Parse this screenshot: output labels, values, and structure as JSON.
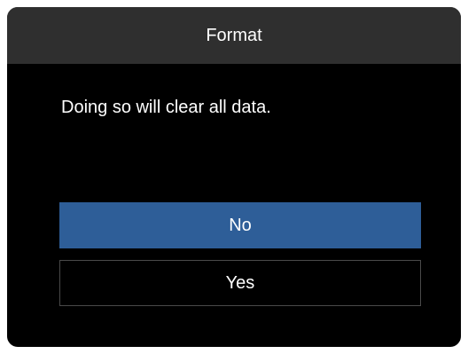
{
  "dialog": {
    "title": "Format",
    "message": "Doing so will clear all data.",
    "options": [
      {
        "label": "No",
        "selected": true
      },
      {
        "label": "Yes",
        "selected": false
      }
    ]
  },
  "colors": {
    "background": "#000000",
    "title_bar": "#2f2f2f",
    "selected_option": "#2e5e98",
    "unselected_border": "#4a4a4a",
    "text": "#ffffff"
  }
}
